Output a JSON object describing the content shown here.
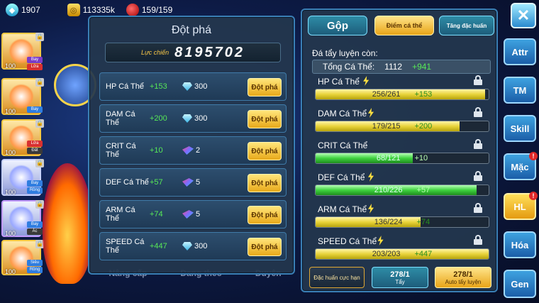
{
  "resources": {
    "gems": "1907",
    "gold": "113335k",
    "stamina": "159/159"
  },
  "pets": [
    {
      "level": "100",
      "tags": [
        "Bay",
        "Lửa"
      ]
    },
    {
      "level": "100",
      "tags": [
        "Bay"
      ]
    },
    {
      "level": "100",
      "tags": [
        "Lửa",
        "Đất"
      ]
    },
    {
      "level": "100",
      "tags": [
        "Bay",
        "Rồng"
      ]
    },
    {
      "level": "100",
      "tags": [
        "Bay",
        "Ác"
      ]
    },
    {
      "level": "100",
      "tags": [
        "Siêu",
        "Rồng"
      ]
    }
  ],
  "bottom_menu": [
    "Nâng cấp",
    "Đang theo",
    "Duyên"
  ],
  "breakthrough": {
    "title": "Đột phá",
    "power_label": "Lực chiến",
    "power_value": "8195702",
    "button_label": "Đột phá",
    "rows": [
      {
        "name": "HP Cá Thể",
        "bonus": "+153",
        "cost": "300",
        "cost_icon": "diamond-icon"
      },
      {
        "name": "DAM Cá Thể",
        "bonus": "+200",
        "cost": "300",
        "cost_icon": "diamond-icon"
      },
      {
        "name": "CRIT Cá Thể",
        "bonus": "+10",
        "cost": "2",
        "cost_icon": "crystal-icon"
      },
      {
        "name": "DEF Cá Thể",
        "bonus": "+57",
        "cost": "5",
        "cost_icon": "crystal-icon"
      },
      {
        "name": "ARM Cá Thể",
        "bonus": "+74",
        "cost": "5",
        "cost_icon": "crystal-icon"
      },
      {
        "name": "SPEED Cá Thể",
        "bonus": "+447",
        "cost": "300",
        "cost_icon": "diamond-icon"
      }
    ]
  },
  "training": {
    "tabs": [
      "Gộp",
      "Điểm cá thể",
      "Tăng đặc huấn"
    ],
    "remaining_label": "Đá tẩy luyện còn:",
    "total_label": "Tổng Cá Thể:",
    "total_value": "1112",
    "total_bonus": "+941",
    "stats": [
      {
        "name": "HP Cá Thể",
        "value": "256/261",
        "bonus": "+153",
        "fill": 0.981,
        "color": "yellow"
      },
      {
        "name": "DAM Cá Thể",
        "value": "179/215",
        "bonus": "+200",
        "fill": 0.833,
        "color": "yellow"
      },
      {
        "name": "CRIT Cá Thể",
        "value": "68/121",
        "bonus": "+10",
        "fill": 0.562,
        "color": "green"
      },
      {
        "name": "DEF Cá Thể",
        "value": "210/226",
        "bonus": "+57",
        "fill": 0.929,
        "color": "green"
      },
      {
        "name": "ARM Cá Thể",
        "value": "136/224",
        "bonus": "+74",
        "fill": 0.607,
        "color": "yellow"
      },
      {
        "name": "SPEED Cá Thể",
        "value": "203/203",
        "bonus": "+447",
        "fill": 1.0,
        "color": "yellow"
      }
    ],
    "bottom_buttons": {
      "special": "Đặc huấn cực hạn",
      "wash_count": "278/1",
      "wash_label": "Tẩy",
      "auto_count": "278/1",
      "auto_label": "Auto tẩy luyện"
    }
  },
  "nav": [
    "Attr",
    "TM",
    "Skill",
    "Mặc",
    "HL",
    "Hóa",
    "Gen"
  ],
  "close_symbol": "✕"
}
